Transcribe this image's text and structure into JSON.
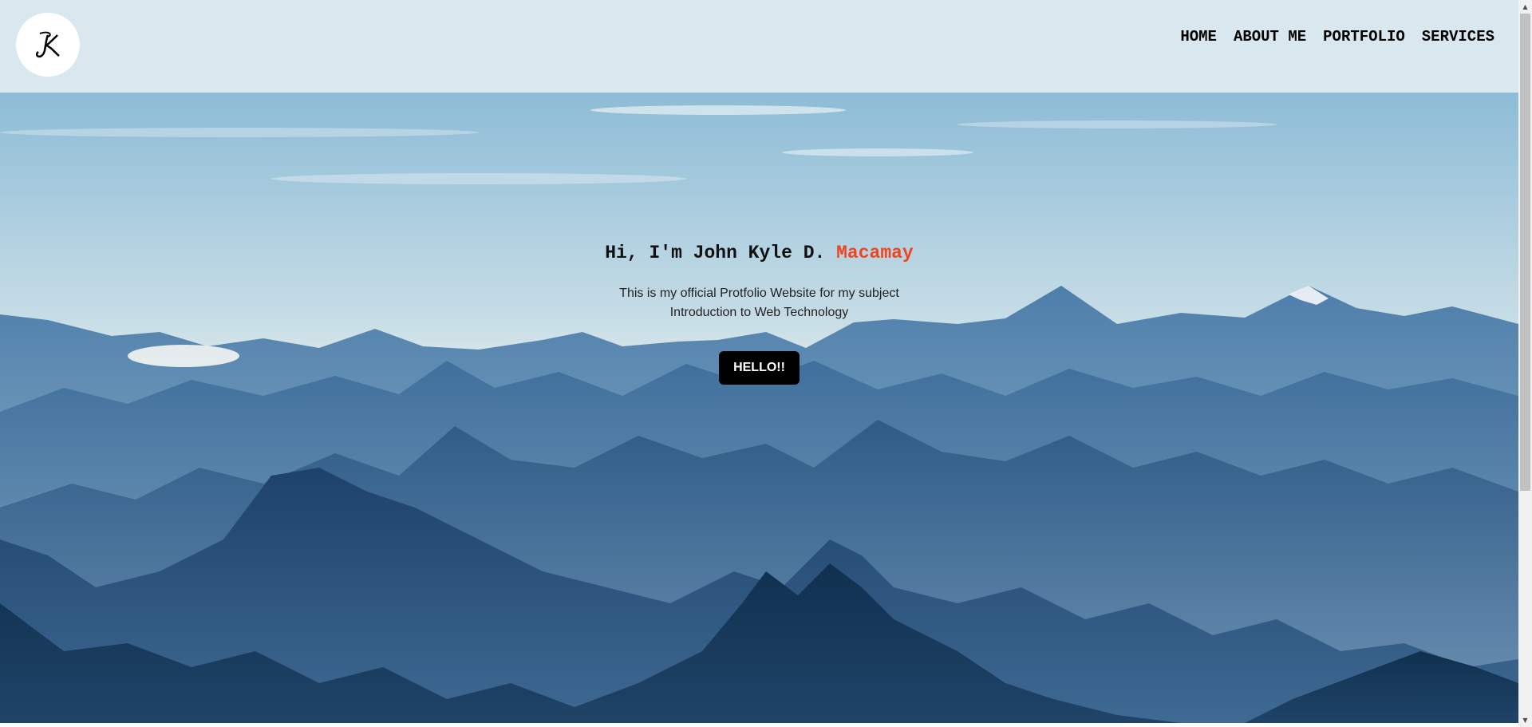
{
  "header": {
    "logo": {
      "icon": "jk-monogram-icon",
      "text": "JK"
    },
    "nav": [
      {
        "label": "HOME"
      },
      {
        "label": "ABOUT ME"
      },
      {
        "label": "PORTFOLIO"
      },
      {
        "label": "SERVICES"
      }
    ]
  },
  "hero": {
    "title_prefix": "Hi, I'm John Kyle D.",
    "title_accent": "Macamay",
    "subtitle_line1": "This is my official Protfolio Website for my subject",
    "subtitle_line2": "Introduction to Web Technology",
    "button_label": "HELLO!!",
    "background": "mountain-landscape-image"
  },
  "colors": {
    "header_bg": "#d9e8ee",
    "accent": "#f0451d",
    "button_bg": "#000000",
    "sky_top": "#8dbcd6",
    "mountain_dark": "#12304f"
  }
}
